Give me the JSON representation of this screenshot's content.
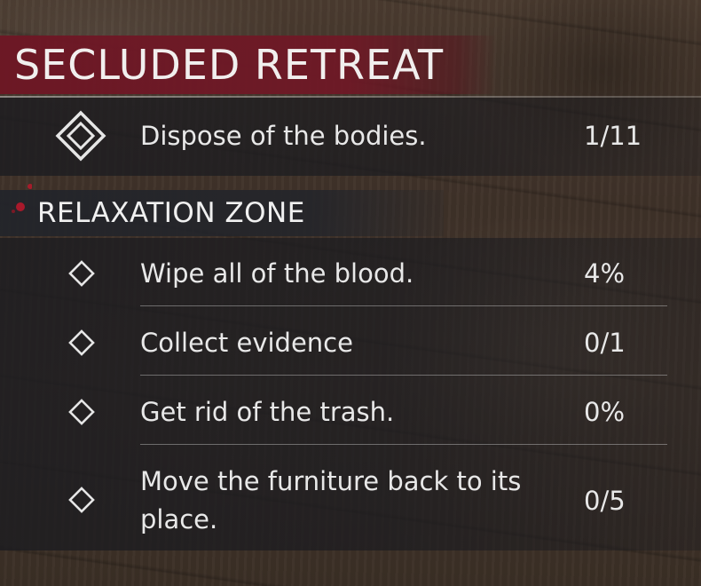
{
  "quest": {
    "title": "SECLUDED RETREAT",
    "main_task": {
      "label": "Dispose of the bodies.",
      "progress": "1/11",
      "icon": "double-diamond-icon"
    }
  },
  "section": {
    "title": "RELAXATION ZONE",
    "tasks": [
      {
        "label": "Wipe all of the blood.",
        "progress": "4%",
        "icon": "diamond-icon"
      },
      {
        "label": "Collect evidence",
        "progress": "0/1",
        "icon": "diamond-icon"
      },
      {
        "label": "Get rid of the trash.",
        "progress": "0%",
        "icon": "diamond-icon"
      },
      {
        "label_line1": "Move the furniture back to its",
        "label_line2": "place.",
        "progress": "0/5",
        "icon": "diamond-icon"
      }
    ]
  },
  "colors": {
    "title_band": "#701826",
    "panel": "#1c1c20",
    "text": "#e8e8e8",
    "blood_accent": "#c0182c"
  }
}
